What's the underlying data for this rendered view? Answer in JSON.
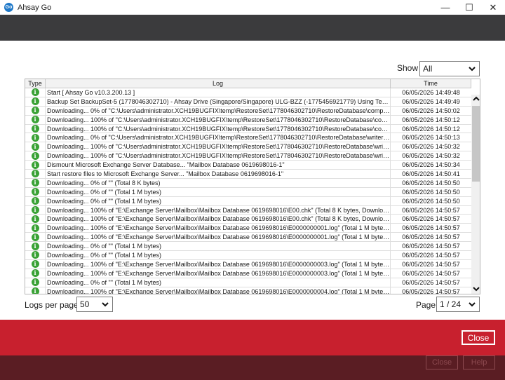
{
  "window": {
    "app_icon_text": "Go",
    "title": "Ahsay Go",
    "minimize": "—",
    "maximize": "☐",
    "close": "✕"
  },
  "filter": {
    "show_label": "Show",
    "show_value": "All"
  },
  "table": {
    "headers": {
      "type": "Type",
      "log": "Log",
      "time": "Time"
    },
    "rows": [
      {
        "log": "Start [ Ahsay Go v10.3.200.13 ]",
        "time": "06/05/2026 14:49:48"
      },
      {
        "log": "Backup Set BackupSet-5 (1778046302710) - Ahsay Drive (Singapore/Singapore) ULG-BZZ (-1775456921779) Using Temp...",
        "time": "06/05/2026 14:49:49"
      },
      {
        "log": "Downloading... 0% of \"C:\\Users\\administrator.XCH19BUGFIX\\temp\\RestoreSet\\1778046302710\\RestoreDatabase\\compo...",
        "time": "06/05/2026 14:50:02"
      },
      {
        "log": "Downloading... 100% of \"C:\\Users\\administrator.XCH19BUGFIX\\temp\\RestoreSet\\1778046302710\\RestoreDatabase\\com...",
        "time": "06/05/2026 14:50:12"
      },
      {
        "log": "Downloading... 100% of \"C:\\Users\\administrator.XCH19BUGFIX\\temp\\RestoreSet\\1778046302710\\RestoreDatabase\\com...",
        "time": "06/05/2026 14:50:12"
      },
      {
        "log": "Downloading... 0% of \"C:\\Users\\administrator.XCH19BUGFIX\\temp\\RestoreSet\\1778046302710\\RestoreDatabase\\writers...",
        "time": "06/05/2026 14:50:13"
      },
      {
        "log": "Downloading... 100% of \"C:\\Users\\administrator.XCH19BUGFIX\\temp\\RestoreSet\\1778046302710\\RestoreDatabase\\write...",
        "time": "06/05/2026 14:50:32"
      },
      {
        "log": "Downloading... 100% of \"C:\\Users\\administrator.XCH19BUGFIX\\temp\\RestoreSet\\1778046302710\\RestoreDatabase\\write...",
        "time": "06/05/2026 14:50:32"
      },
      {
        "log": "Dismount Microsoft Exchange Server Database... \"Mailbox Database 0619698016-1\"",
        "time": "06/05/2026 14:50:34"
      },
      {
        "log": "Start restore files to Microsoft Exchange Server... \"Mailbox Database 0619698016-1\"",
        "time": "06/05/2026 14:50:41"
      },
      {
        "log": "Downloading... 0% of \"\" (Total 8 K bytes)",
        "time": "06/05/2026 14:50:50"
      },
      {
        "log": "Downloading... 0% of \"\" (Total 1 M bytes)",
        "time": "06/05/2026 14:50:50"
      },
      {
        "log": "Downloading... 0% of \"\" (Total 1 M bytes)",
        "time": "06/05/2026 14:50:50"
      },
      {
        "log": "Downloading... 100% of \"E:\\Exchange Server\\Mailbox\\Mailbox Database 0619698016\\E00.chk\" (Total 8 K bytes, Download...",
        "time": "06/05/2026 14:50:57"
      },
      {
        "log": "Downloading... 100% of \"E:\\Exchange Server\\Mailbox\\Mailbox Database 0619698016\\E00.chk\" (Total 8 K bytes, Download...",
        "time": "06/05/2026 14:50:57"
      },
      {
        "log": "Downloading... 100% of \"E:\\Exchange Server\\Mailbox\\Mailbox Database 0619698016\\E0000000001.log\" (Total 1 M bytes, ...",
        "time": "06/05/2026 14:50:57"
      },
      {
        "log": "Downloading... 100% of \"E:\\Exchange Server\\Mailbox\\Mailbox Database 0619698016\\E0000000001.log\" (Total 1 M bytes, ...",
        "time": "06/05/2026 14:50:57"
      },
      {
        "log": "Downloading... 0% of \"\" (Total 1 M bytes)",
        "time": "06/05/2026 14:50:57"
      },
      {
        "log": "Downloading... 0% of \"\" (Total 1 M bytes)",
        "time": "06/05/2026 14:50:57"
      },
      {
        "log": "Downloading... 100% of \"E:\\Exchange Server\\Mailbox\\Mailbox Database 0619698016\\E0000000003.log\" (Total 1 M bytes, ...",
        "time": "06/05/2026 14:50:57"
      },
      {
        "log": "Downloading... 100% of \"E:\\Exchange Server\\Mailbox\\Mailbox Database 0619698016\\E0000000003.log\" (Total 1 M bytes, ...",
        "time": "06/05/2026 14:50:57"
      },
      {
        "log": "Downloading... 0% of \"\" (Total 1 M bytes)",
        "time": "06/05/2026 14:50:57"
      },
      {
        "log": "Downloading... 100% of \"E:\\Exchange Server\\Mailbox\\Mailbox Database 0619698016\\E0000000004.log\" (Total 1 M bytes, ...",
        "time": "06/05/2026 14:50:57"
      }
    ]
  },
  "pagination": {
    "logs_per_page_label": "Logs per page",
    "logs_per_page_value": "50",
    "page_label": "Page",
    "page_value": "1 / 24"
  },
  "footer": {
    "close_label": "Close",
    "ghost_close_label": "Close",
    "ghost_help_label": "Help"
  },
  "colors": {
    "dark_header": "#3b3b3d",
    "red_bar": "#c8202e",
    "bottom_bar": "#5a1d23",
    "info_icon": "#3aa236"
  }
}
